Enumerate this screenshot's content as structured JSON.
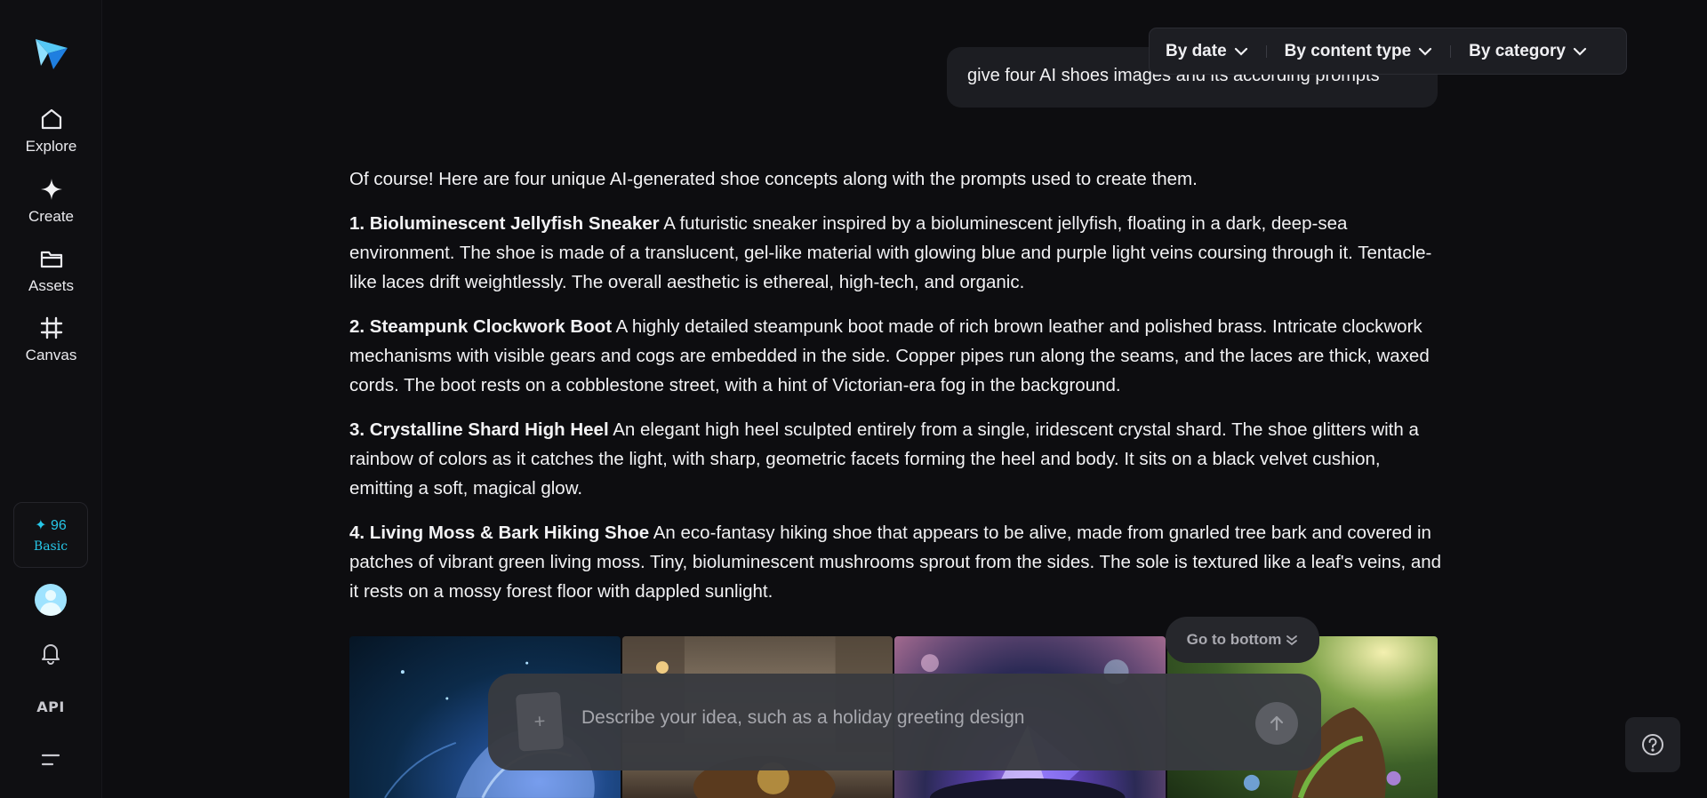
{
  "sidebar": {
    "items": [
      {
        "label": "Explore",
        "icon": "home-icon"
      },
      {
        "label": "Create",
        "icon": "sparkle-icon"
      },
      {
        "label": "Assets",
        "icon": "folder-icon"
      },
      {
        "label": "Canvas",
        "icon": "frame-icon"
      }
    ],
    "credits": {
      "count": "✦ 96",
      "plan": "Basic"
    },
    "api_label": "API"
  },
  "filters": [
    {
      "label": "By date"
    },
    {
      "label": "By content type"
    },
    {
      "label": "By category"
    }
  ],
  "user_message": "give four AI shoes images and its according prompts",
  "answer": {
    "intro": "Of course! Here are four unique AI-generated shoe concepts along with the prompts used to create them.",
    "items": [
      {
        "title": "1. Bioluminescent Jellyfish Sneaker",
        "text": " A futuristic sneaker inspired by a bioluminescent jellyfish, floating in a dark, deep-sea environment. The shoe is made of a translucent, gel-like material with glowing blue and purple light veins coursing through it. Tentacle-like laces drift weightlessly. The overall aesthetic is ethereal, high-tech, and organic."
      },
      {
        "title": "2. Steampunk Clockwork Boot",
        "text": " A highly detailed steampunk boot made of rich brown leather and polished brass. Intricate clockwork mechanisms with visible gears and cogs are embedded in the side. Copper pipes run along the seams, and the laces are thick, waxed cords. The boot rests on a cobblestone street, with a hint of Victorian-era fog in the background."
      },
      {
        "title": "3. Crystalline Shard High Heel",
        "text": " An elegant high heel sculpted entirely from a single, iridescent crystal shard. The shoe glitters with a rainbow of colors as it catches the light, with sharp, geometric facets forming the heel and body. It sits on a black velvet cushion, emitting a soft, magical glow."
      },
      {
        "title": "4. Living Moss & Bark Hiking Shoe",
        "text": " An eco-fantasy hiking shoe that appears to be alive, made from gnarled tree bark and covered in patches of vibrant green living moss. Tiny, bioluminescent mushrooms sprout from the sides. The sole is textured like a leaf's veins, and it rests on a mossy forest floor with dappled sunlight."
      }
    ]
  },
  "go_bottom_label": "Go to bottom",
  "composer": {
    "placeholder": "Describe your idea, such as a holiday greeting design",
    "attach_glyph": "+"
  },
  "colors": {
    "accent": "#27c7e8",
    "background": "#0d0d10"
  }
}
